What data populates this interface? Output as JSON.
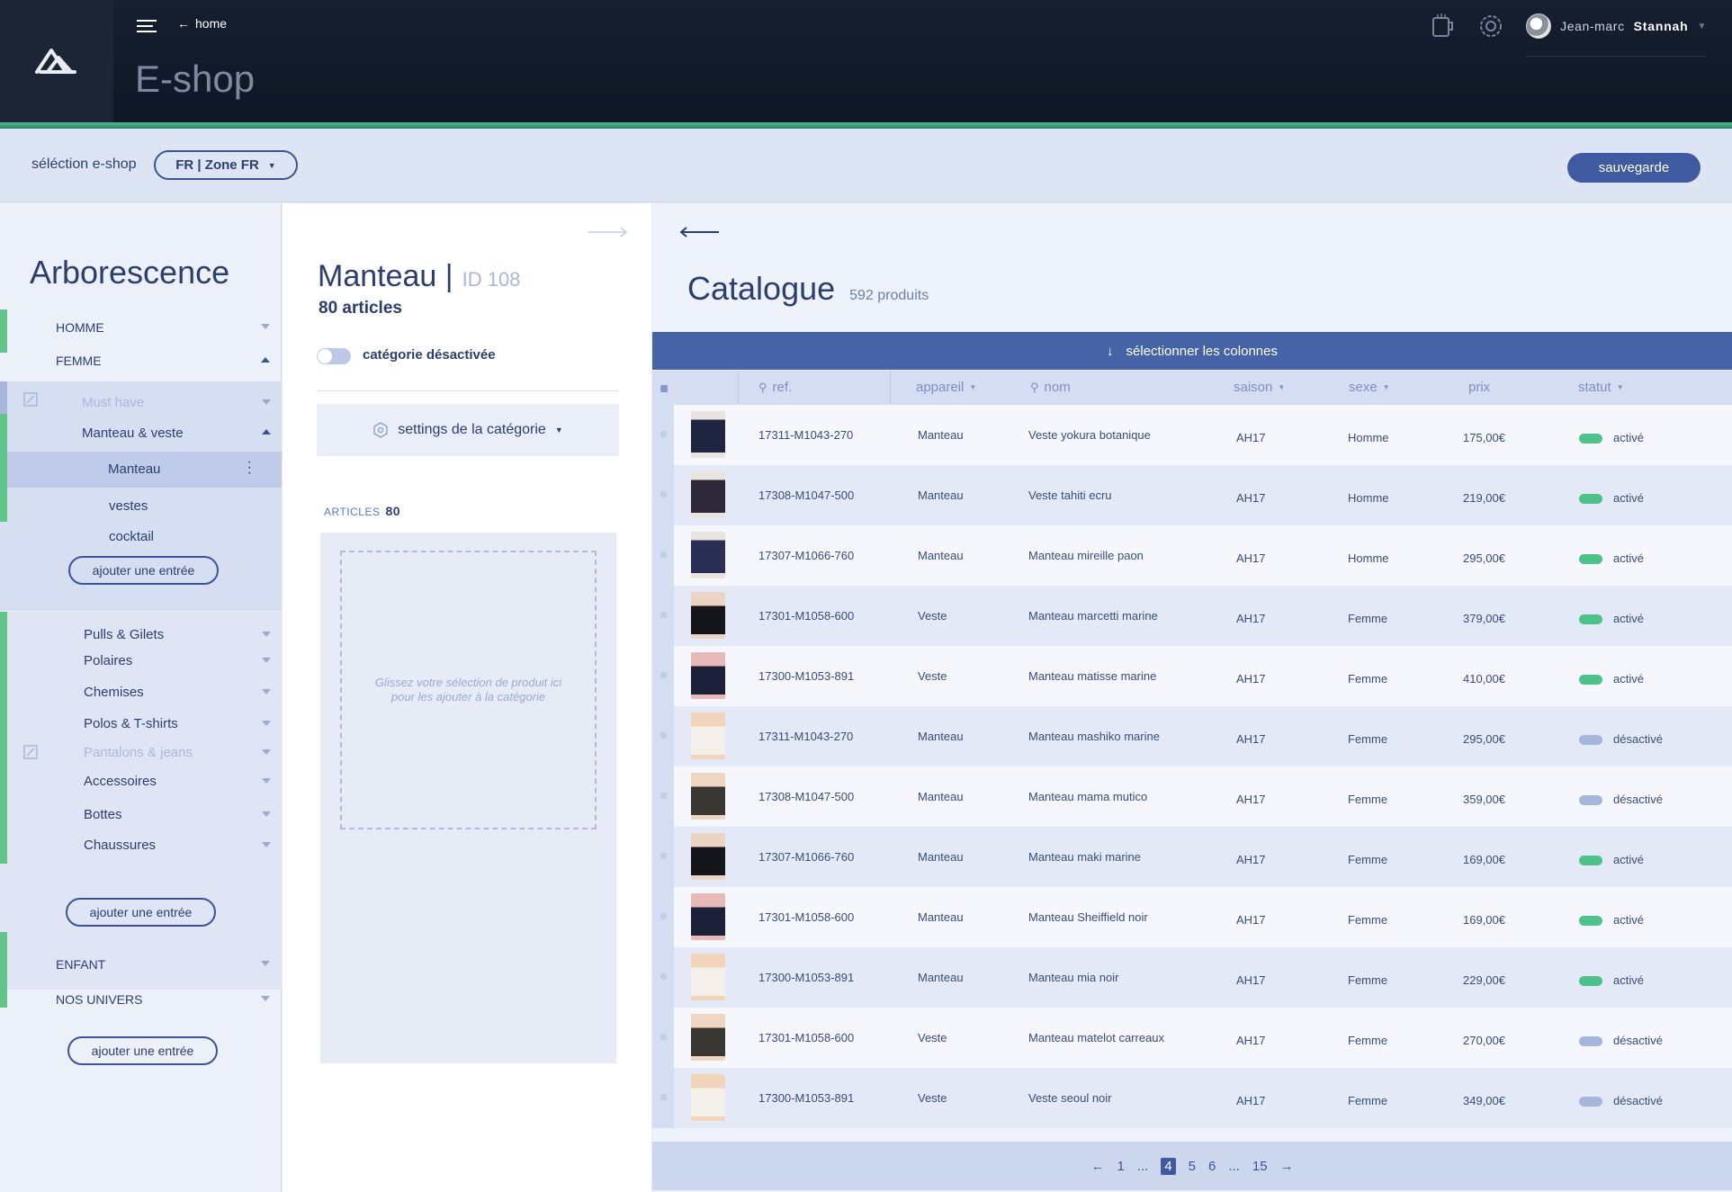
{
  "header": {
    "home_label": "home",
    "app_title": "E-shop",
    "user_first": "Jean-marc",
    "user_last": "Stannah"
  },
  "toolbar": {
    "shop_label": "séléction e-shop",
    "shop_value": "FR | Zone FR",
    "save_label": "sauvegarde"
  },
  "tree": {
    "title": "Arborescence",
    "top": [
      {
        "label": "HOMME"
      },
      {
        "label": "FEMME"
      }
    ],
    "femme_sub": [
      {
        "label": "Must have",
        "disabled": true
      },
      {
        "label": "Manteau & veste"
      }
    ],
    "manteau_sub": [
      {
        "label": "Manteau"
      },
      {
        "label": "vestes"
      },
      {
        "label": "cocktail"
      }
    ],
    "add_label": "ajouter une entrée",
    "other": [
      {
        "label": "Pulls & Gilets"
      },
      {
        "label": "Polaires"
      },
      {
        "label": "Chemises"
      },
      {
        "label": "Polos & T-shirts"
      },
      {
        "label": "Pantalons & jeans",
        "disabled": true
      },
      {
        "label": "Accessoires"
      },
      {
        "label": "Bottes"
      },
      {
        "label": "Chaussures"
      }
    ],
    "bottom": [
      {
        "label": "ENFANT"
      },
      {
        "label": "NOS UNIVERS"
      }
    ]
  },
  "category": {
    "name": "Manteau |",
    "id": "ID 108",
    "count": "80 articles",
    "toggle_label": "catégorie désactivée",
    "settings_label": "settings de la catégorie",
    "articles_label": "ARTICLES",
    "articles_count": "80",
    "drop_text": "Glissez votre sélection  de produit ici pour les ajouter à la catégorie"
  },
  "catalogue": {
    "title": "Catalogue",
    "count": "592 produits",
    "select_columns": "sélectionner les colonnes",
    "columns": {
      "ref": "ref.",
      "appareil": "appareil",
      "nom": "nom",
      "saison": "saison",
      "sexe": "sexe",
      "prix": "prix",
      "statut": "statut"
    },
    "rows": [
      {
        "ref": "17311-M1043-270",
        "appareil": "Manteau",
        "nom": "Veste yokura botanique",
        "saison": "AH17",
        "sexe": "Homme",
        "prix": "175,00€",
        "statut": "activé"
      },
      {
        "ref": "17308-M1047-500",
        "appareil": "Manteau",
        "nom": "Veste tahiti ecru",
        "saison": "AH17",
        "sexe": "Homme",
        "prix": "219,00€",
        "statut": "activé"
      },
      {
        "ref": "17307-M1066-760",
        "appareil": "Manteau",
        "nom": "Manteau mireille paon",
        "saison": "AH17",
        "sexe": "Homme",
        "prix": "295,00€",
        "statut": "activé"
      },
      {
        "ref": "17301-M1058-600",
        "appareil": "Veste",
        "nom": "Manteau marcetti marine",
        "saison": "AH17",
        "sexe": "Femme",
        "prix": "379,00€",
        "statut": "activé"
      },
      {
        "ref": "17300-M1053-891",
        "appareil": "Veste",
        "nom": "Manteau matisse marine",
        "saison": "AH17",
        "sexe": "Femme",
        "prix": "410,00€",
        "statut": "activé"
      },
      {
        "ref": "17311-M1043-270",
        "appareil": "Manteau",
        "nom": "Manteau mashiko marine",
        "saison": "AH17",
        "sexe": "Femme",
        "prix": "295,00€",
        "statut": "désactivé"
      },
      {
        "ref": "17308-M1047-500",
        "appareil": "Manteau",
        "nom": "Manteau mama mutico",
        "saison": "AH17",
        "sexe": "Femme",
        "prix": "359,00€",
        "statut": "désactivé"
      },
      {
        "ref": "17307-M1066-760",
        "appareil": "Manteau",
        "nom": "Manteau maki marine",
        "saison": "AH17",
        "sexe": "Femme",
        "prix": "169,00€",
        "statut": "activé"
      },
      {
        "ref": "17301-M1058-600",
        "appareil": "Manteau",
        "nom": "Manteau Sheiffield noir",
        "saison": "AH17",
        "sexe": "Femme",
        "prix": "169,00€",
        "statut": "activé"
      },
      {
        "ref": "17300-M1053-891",
        "appareil": "Manteau",
        "nom": "Manteau mia noir",
        "saison": "AH17",
        "sexe": "Femme",
        "prix": "229,00€",
        "statut": "activé"
      },
      {
        "ref": "17301-M1058-600",
        "appareil": "Veste",
        "nom": "Manteau matelot carreaux",
        "saison": "AH17",
        "sexe": "Femme",
        "prix": "270,00€",
        "statut": "désactivé"
      },
      {
        "ref": "17300-M1053-891",
        "appareil": "Veste",
        "nom": "Veste seoul noir",
        "saison": "AH17",
        "sexe": "Femme",
        "prix": "349,00€",
        "statut": "désactivé"
      }
    ],
    "pager": {
      "pages": [
        "1",
        "...",
        "4",
        "5",
        "6",
        "...",
        "15"
      ],
      "current": "4"
    }
  },
  "colors": {
    "accent": "#3f5aa0",
    "green": "#62c48a",
    "active": "#4ec28a",
    "inactive": "#a6b5dc"
  }
}
